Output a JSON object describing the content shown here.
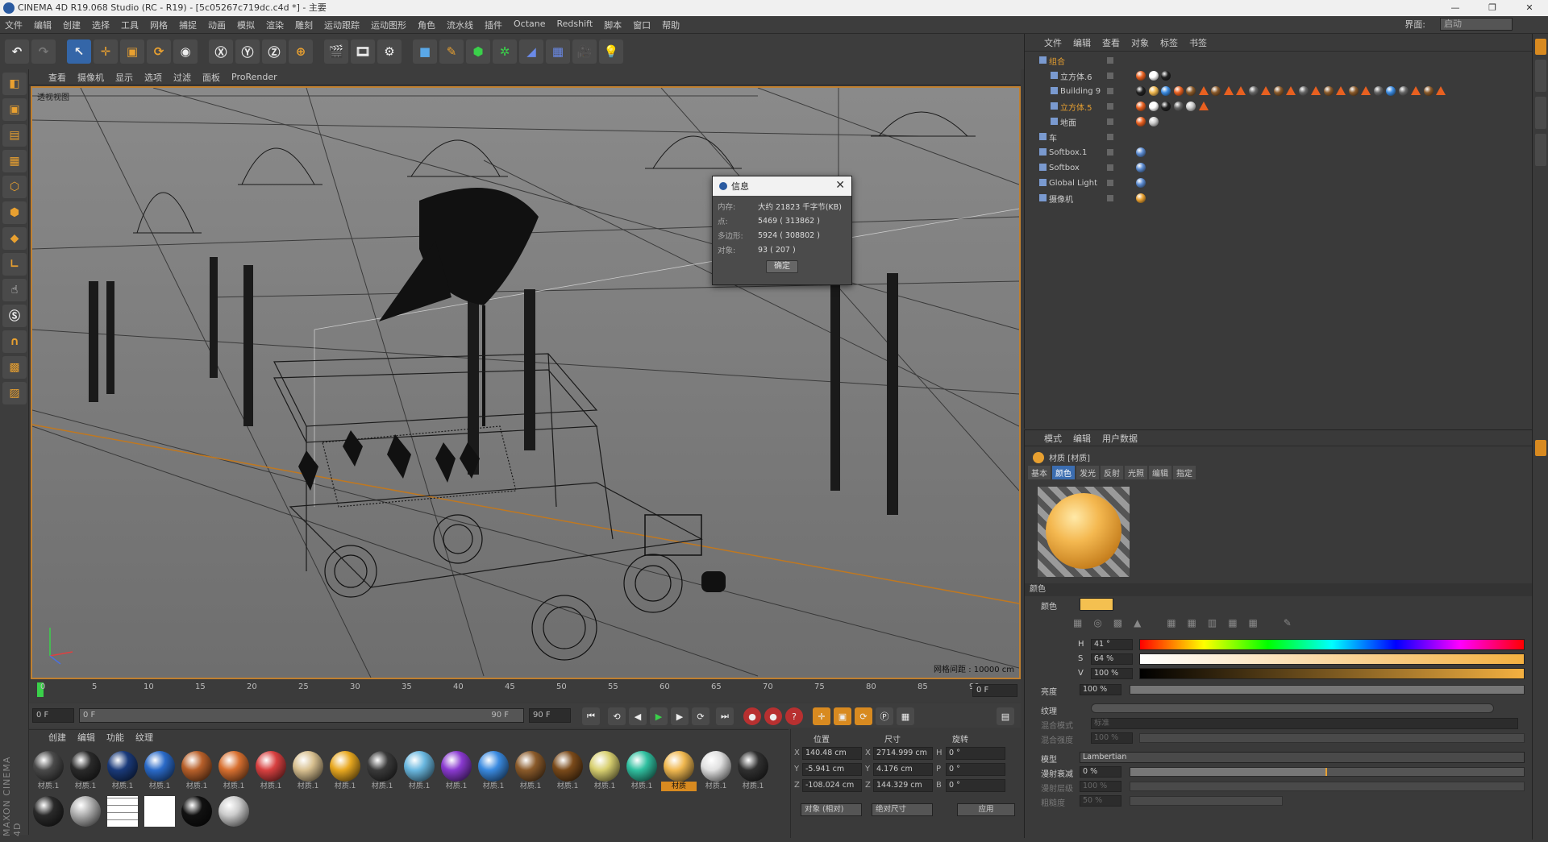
{
  "window": {
    "title": "CINEMA 4D R19.068 Studio (RC - R19) - [5c05267c719dc.c4d *] - 主要"
  },
  "menubar": {
    "items": [
      "文件",
      "编辑",
      "创建",
      "选择",
      "工具",
      "网格",
      "捕捉",
      "动画",
      "模拟",
      "渲染",
      "雕刻",
      "运动跟踪",
      "运动图形",
      "角色",
      "流水线",
      "插件",
      "Octane",
      "Redshift",
      "脚本",
      "窗口",
      "帮助"
    ],
    "layout_label": "界面:",
    "layout_value": "启动"
  },
  "toolbar": {
    "buttons": [
      "undo-icon",
      "redo-icon",
      "select-icon",
      "move-icon",
      "scale-icon",
      "rotate-icon",
      "live-select-icon",
      "X",
      "Y",
      "Z",
      "world-icon",
      "render-view-icon",
      "render-picture-icon",
      "render-settings-icon",
      "cube-icon",
      "pen-icon",
      "subdivision-icon",
      "cloner-icon",
      "deformer-icon",
      "floor-icon",
      "camera-icon",
      "light-icon"
    ]
  },
  "viewport": {
    "menu": [
      "查看",
      "摄像机",
      "显示",
      "选项",
      "过滤",
      "面板",
      "ProRender"
    ],
    "name": "透视视图",
    "grid_info": "网格间距 : 10000 cm"
  },
  "dialog": {
    "title": "信息",
    "rows": [
      {
        "k": "内存:",
        "v": "大约 21823 千字节(KB)"
      },
      {
        "k": "点:",
        "v": "5469 ( 313862 )"
      },
      {
        "k": "多边形:",
        "v": "5924 ( 308802 )"
      },
      {
        "k": "对象:",
        "v": "93 ( 207 )"
      }
    ],
    "ok": "确定"
  },
  "timeline": {
    "ticks": [
      "0",
      "5",
      "10",
      "15",
      "20",
      "25",
      "30",
      "35",
      "40",
      "45",
      "50",
      "55",
      "60",
      "65",
      "70",
      "75",
      "80",
      "85",
      "90"
    ],
    "frame": "0 F"
  },
  "transport": {
    "start": "0 F",
    "range_start": "0 F",
    "range_end": "90 F",
    "end": "90 F"
  },
  "materials": {
    "tabs": [
      "创建",
      "编辑",
      "功能",
      "纹理"
    ],
    "label": "材质.1",
    "selected_label": "材质",
    "colors": [
      "#4a4a4a",
      "#2a2a2a",
      "#1a3a7a",
      "#2a6ac8",
      "#b8602a",
      "#d87030",
      "#d84040",
      "#d8c090",
      "#e8a820",
      "#3a3a3a",
      "#6ab8e0",
      "#8a3ad0",
      "#3a8ae0",
      "#8a5a2a",
      "#7a4a1a",
      "#d8d070",
      "#30c0a0",
      "#f0b850",
      "#e0e0e0",
      "#303030"
    ],
    "row2": [
      "#2a2a2a",
      "#b0b0b0",
      "grid",
      "#ffffff",
      "#111111",
      "#cccccc"
    ]
  },
  "coord": {
    "headers": [
      "位置",
      "尺寸",
      "旋转"
    ],
    "rows": [
      {
        "ax": "X",
        "p": "140.48 cm",
        "s": "2714.999 cm",
        "r": "H",
        "rv": "0 °"
      },
      {
        "ax": "Y",
        "p": "-5.941 cm",
        "s": "4.176 cm",
        "r": "P",
        "rv": "0 °"
      },
      {
        "ax": "Z",
        "p": "-108.024 cm",
        "s": "144.329 cm",
        "r": "B",
        "rv": "0 °"
      }
    ],
    "mode1": "对象 (相对)",
    "mode2": "绝对尺寸",
    "apply": "应用"
  },
  "objects": {
    "menu": [
      "文件",
      "编辑",
      "查看",
      "对象",
      "标签",
      "书签"
    ],
    "rows": [
      {
        "name": "组合",
        "indent": 18,
        "hl": true,
        "tags": []
      },
      {
        "name": "立方体.6",
        "indent": 32,
        "hl": false,
        "tags": [
          "#e86020",
          "#ffffff",
          "#222222"
        ]
      },
      {
        "name": "Building 9",
        "indent": 32,
        "hl": false,
        "tags": [
          "#222222",
          "#f0b850",
          "#3a8ae0",
          "#e86020",
          "#8a5a2a",
          "tri",
          "#8a5a2a",
          "tri",
          "tri",
          "#666666",
          "tri",
          "#8a5a2a",
          "tri",
          "#666666",
          "tri",
          "#8a5a2a",
          "tri",
          "#8a5a2a",
          "tri",
          "#666666",
          "#3a8ae0",
          "#666666",
          "tri",
          "#8a5a2a",
          "tri"
        ]
      },
      {
        "name": "立方体.5",
        "indent": 32,
        "hl": true,
        "tags": [
          "#e86020",
          "#ffffff",
          "#222222",
          "#666666",
          "#cccccc",
          "tri"
        ]
      },
      {
        "name": "地面",
        "indent": 32,
        "hl": false,
        "tags": [
          "#e86020",
          "#cccccc"
        ]
      },
      {
        "name": "车",
        "indent": 18,
        "hl": false,
        "tags": []
      },
      {
        "name": "Softbox.1",
        "indent": 18,
        "hl": false,
        "tags": [
          "#5a8ad0"
        ]
      },
      {
        "name": "Softbox",
        "indent": 18,
        "hl": false,
        "tags": [
          "#5a8ad0"
        ]
      },
      {
        "name": "Global Light",
        "indent": 18,
        "hl": false,
        "tags": [
          "#5a8ad0"
        ]
      },
      {
        "name": "摄像机",
        "indent": 18,
        "hl": false,
        "tags": [
          "#e8a030"
        ]
      }
    ]
  },
  "attributes": {
    "menu": [
      "模式",
      "编辑",
      "用户数据"
    ],
    "title": "材质 [材质]",
    "tabs": [
      "基本",
      "颜色",
      "发光",
      "反射",
      "光照",
      "编辑",
      "指定"
    ],
    "active_tab": "颜色",
    "section_color": "颜色",
    "color_label": "颜色",
    "swatch": "#f4c050",
    "h": {
      "label": "H",
      "value": "41 °"
    },
    "s": {
      "label": "S",
      "value": "64 %"
    },
    "v": {
      "label": "V",
      "value": "100 %"
    },
    "brightness": {
      "label": "亮度",
      "value": "100 %"
    },
    "texture_label": "纹理",
    "mix_mode": {
      "label": "混合模式",
      "value": "标准"
    },
    "mix_strength": {
      "label": "混合强度",
      "value": "100 %"
    },
    "model": {
      "label": "模型",
      "value": "Lambertian"
    },
    "diffuse_falloff": {
      "label": "漫射衰减",
      "value": "0 %"
    },
    "diffuse_level": {
      "label": "漫射层级",
      "value": "100 %"
    },
    "roughness": {
      "label": "粗糙度",
      "value": "50 %"
    }
  },
  "branding": {
    "text": "MAXON CINEMA 4D"
  }
}
